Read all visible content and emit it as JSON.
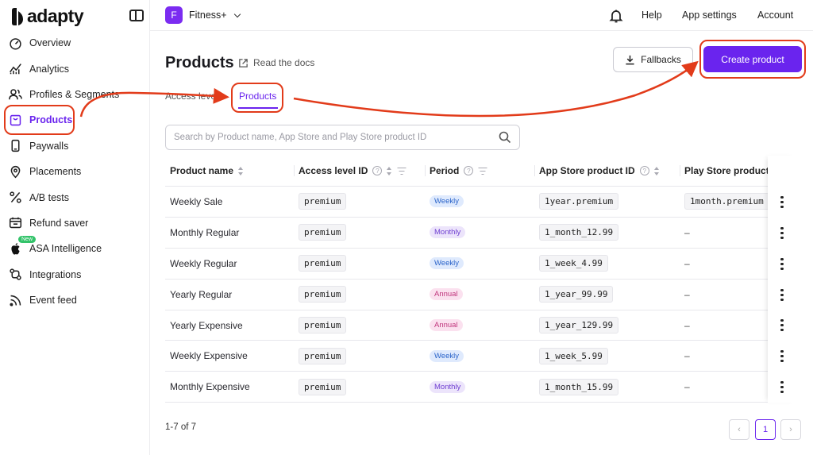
{
  "brand": {
    "name": "adapty"
  },
  "sidebar": {
    "items": [
      {
        "label": "Overview",
        "icon": "gauge-icon",
        "active": false
      },
      {
        "label": "Analytics",
        "icon": "analytics-chart-icon",
        "active": false
      },
      {
        "label": "Profiles & Segments",
        "icon": "users-icon",
        "active": false
      },
      {
        "label": "Products",
        "icon": "product-box-icon",
        "active": true
      },
      {
        "label": "Paywalls",
        "icon": "phone-icon",
        "active": false
      },
      {
        "label": "Placements",
        "icon": "map-pin-icon",
        "active": false
      },
      {
        "label": "A/B tests",
        "icon": "percent-icon",
        "active": false
      },
      {
        "label": "Refund saver",
        "icon": "calendar-refund-icon",
        "active": false
      },
      {
        "label": "ASA Intelligence",
        "icon": "apple-icon",
        "active": false,
        "badge": "New"
      },
      {
        "label": "Integrations",
        "icon": "integrations-icon",
        "active": false
      },
      {
        "label": "Event feed",
        "icon": "rss-icon",
        "active": false
      }
    ]
  },
  "topbar": {
    "app_initial": "F",
    "app_name": "Fitness+",
    "help": "Help",
    "app_settings": "App settings",
    "account": "Account"
  },
  "header": {
    "title": "Products",
    "docs_link": "Read the docs",
    "fallbacks_button": "Fallbacks",
    "create_button": "Create product"
  },
  "tabs": [
    {
      "label": "Access levels",
      "active": false
    },
    {
      "label": "Products",
      "active": true
    }
  ],
  "search": {
    "placeholder": "Search by Product name, App Store and Play Store product ID",
    "value": ""
  },
  "table": {
    "columns": [
      "Product name",
      "Access level ID",
      "Period",
      "App Store product ID",
      "Play Store product ID"
    ],
    "rows": [
      {
        "name": "Weekly Sale",
        "access": "premium",
        "period": "Weekly",
        "app_store": "1year.premium",
        "play_store": "1month.premium"
      },
      {
        "name": "Monthly Regular",
        "access": "premium",
        "period": "Monthly",
        "app_store": "1_month_12.99",
        "play_store": "–"
      },
      {
        "name": "Weekly Regular",
        "access": "premium",
        "period": "Weekly",
        "app_store": "1_week_4.99",
        "play_store": "–"
      },
      {
        "name": "Yearly Regular",
        "access": "premium",
        "period": "Annual",
        "app_store": "1_year_99.99",
        "play_store": "–"
      },
      {
        "name": "Yearly Expensive",
        "access": "premium",
        "period": "Annual",
        "app_store": "1_year_129.99",
        "play_store": "–"
      },
      {
        "name": "Weekly Expensive",
        "access": "premium",
        "period": "Weekly",
        "app_store": "1_week_5.99",
        "play_store": "–"
      },
      {
        "name": "Monthly Expensive",
        "access": "premium",
        "period": "Monthly",
        "app_store": "1_month_15.99",
        "play_store": "–"
      }
    ]
  },
  "pagination": {
    "summary": "1-7 of 7",
    "current_page": "1",
    "prev": "‹",
    "next": "›"
  },
  "colors": {
    "accent": "#6a24ee",
    "annotation": "#e23b1a"
  }
}
